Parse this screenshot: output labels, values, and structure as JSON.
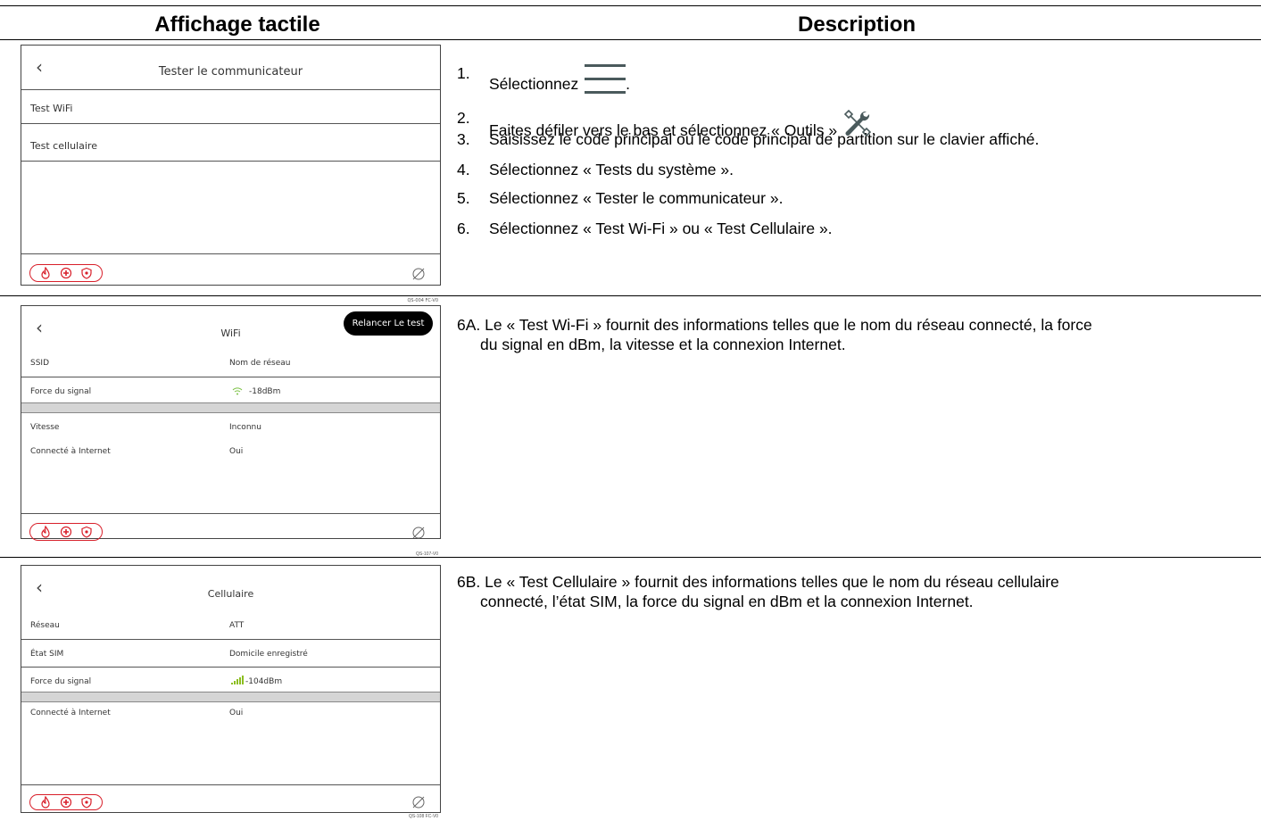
{
  "headers": {
    "col1": "Affichage tactile",
    "col2": "Description"
  },
  "steps": [
    {
      "num": "1.",
      "text": "Sélectionnez",
      "suffix": ".",
      "icon": "menu-icon"
    },
    {
      "num": "2.",
      "text": "Faites défiler vers le bas et sélectionnez « Outils »",
      "suffix": ".",
      "icon": "tools-icon"
    },
    {
      "num": "3.",
      "text": "Saisissez le code principal ou le code principal de partition sur le clavier affiché."
    },
    {
      "num": "4.",
      "text": "Sélectionnez « Tests du système »."
    },
    {
      "num": "5.",
      "text": "Sélectionnez « Tester le communicateur »."
    },
    {
      "num": "6.",
      "text": "Sélectionnez « Test Wi-Fi » ou « Test Cellulaire »."
    }
  ],
  "desc_6a": {
    "line1": "6A. Le « Test Wi-Fi » fournit des informations telles que le nom du réseau connecté, la force",
    "line2": "du signal en dBm, la vitesse et la connexion Internet."
  },
  "desc_6b": {
    "line1": "6B. Le « Test Cellulaire » fournit des informations telles que le nom du réseau cellulaire",
    "line2": "connecté, l’état SIM, la force du signal en dBm et la connexion Internet."
  },
  "screen1": {
    "title": "Tester le communicateur",
    "items": [
      "Test WiFi",
      "Test cellulaire"
    ],
    "code": "QS-004 FC-V0"
  },
  "screen2": {
    "title": "WiFi",
    "rerun_label": "Relancer Le test",
    "rows": [
      {
        "label": "SSID",
        "value": "Nom de réseau"
      },
      {
        "label": "Force du signal",
        "value": "-18dBm"
      },
      {
        "label": "Vitesse",
        "value": "Inconnu"
      },
      {
        "label": "Connecté à Internet",
        "value": "Oui"
      }
    ],
    "code": "QS-107-V0"
  },
  "screen3": {
    "title": "Cellulaire",
    "rows": [
      {
        "label": "Réseau",
        "value": "ATT"
      },
      {
        "label": "État SIM",
        "value": "Domicile enregistré"
      },
      {
        "label": "Force du signal",
        "value": "-104dBm"
      },
      {
        "label": "Connecté à Internet",
        "value": "Oui"
      }
    ],
    "code": "QS-108 FC-V0"
  },
  "colors": {
    "emergency": "#d81f2a",
    "wifi_signal": "#7ac143",
    "cell_signal": "#8cbe22"
  }
}
